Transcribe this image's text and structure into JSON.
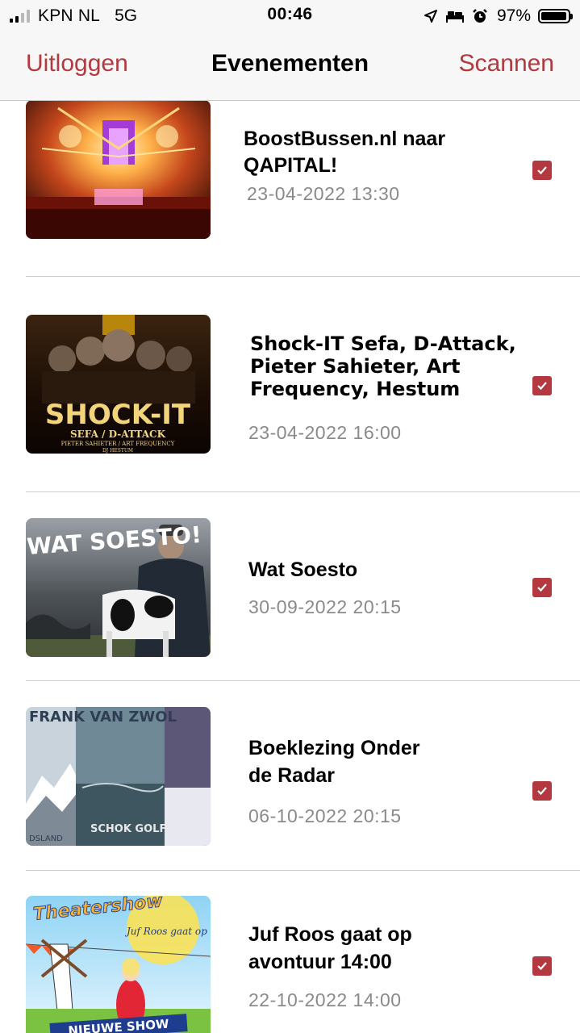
{
  "status_bar": {
    "carrier": "KPN NL",
    "network": "5G",
    "time": "00:46",
    "battery_percent": "97%",
    "battery_level": 0.97,
    "icons": [
      "signal-icon",
      "location-arrow-icon",
      "bed-icon",
      "alarm-icon",
      "battery-icon"
    ]
  },
  "nav": {
    "left_label": "Uitloggen",
    "title": "Evenementen",
    "right_label": "Scannen",
    "accent_color": "#b3383f"
  },
  "events": [
    {
      "title_lines": [
        "BoostBussen.nl naar",
        "QAPITAL!"
      ],
      "date": "23-04-2022 13:30",
      "checked": true,
      "image": "concert-stage-image"
    },
    {
      "title_lines": [
        "Shock-IT Sefa, D-Attack,",
        "Pieter Sahieter, Art",
        "Frequency, Hestum"
      ],
      "date": "23-04-2022 16:00",
      "checked": true,
      "image": "shock-it-poster-image",
      "poster_text": {
        "headline": "SHOCK-IT",
        "sub": "SEFA / D-ATTACK",
        "sub2": "PIETER SAHIETER / ART FREQUENCY",
        "sub3": "DJ HESTUM"
      }
    },
    {
      "title_lines": [
        "Wat Soesto"
      ],
      "date": "30-09-2022 20:15",
      "checked": true,
      "image": "wat-soesto-poster-image",
      "poster_text": {
        "headline": "WAT SOESTO!"
      }
    },
    {
      "title_lines": [
        "Boeklezing Onder",
        "de Radar"
      ],
      "date": "06-10-2022 20:15",
      "checked": true,
      "image": "book-covers-image",
      "poster_text": {
        "book1": "FRANK VAN ZWOL",
        "book2": "SCHOK GOLF",
        "book3": "DSLAND"
      }
    },
    {
      "title_lines": [
        "Juf Roos gaat op",
        "avontuur 14:00"
      ],
      "date": "22-10-2022 14:00",
      "checked": true,
      "image": "theatershow-poster-image",
      "poster_text": {
        "headline": "Theatershow",
        "sub": "Juf Roos gaat op avontuur",
        "banner": "NIEUWE SHOW"
      }
    }
  ]
}
